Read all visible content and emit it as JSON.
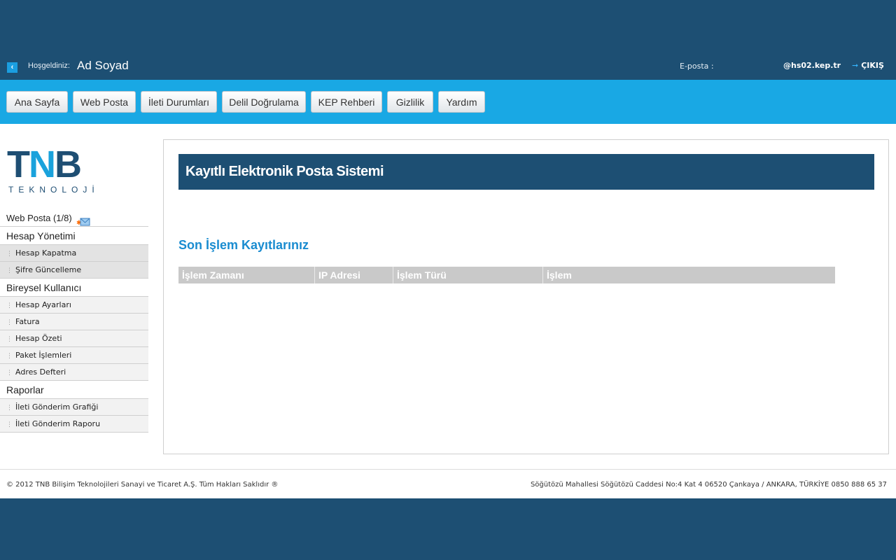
{
  "topbar": {
    "welcome_label": "Hoşgeldiniz:",
    "user_name": "Ad Soyad",
    "email_label": "E-posta :",
    "email_value": "@hs02.kep.tr",
    "logout_label": "ÇIKIŞ"
  },
  "nav": [
    {
      "label": "Ana Sayfa"
    },
    {
      "label": "Web Posta"
    },
    {
      "label": "İleti Durumları"
    },
    {
      "label": "Delil Doğrulama"
    },
    {
      "label": "KEP Rehberi"
    },
    {
      "label": "Gizlilik"
    },
    {
      "label": "Yardım"
    }
  ],
  "logo": {
    "main_a": "T",
    "main_n": "N",
    "main_b": "B",
    "sub": "TEKNOLOJİ"
  },
  "sidebar": {
    "web_posta": "Web Posta (1/8)",
    "groups": [
      {
        "title": "Hesap Yönetimi",
        "items": [
          "Hesap Kapatma",
          "Şifre Güncelleme"
        ]
      },
      {
        "title": "Bireysel Kullanıcı",
        "items": [
          "Hesap Ayarları",
          "Fatura",
          "Hesap Özeti",
          "Paket İşlemleri",
          "Adres Defteri"
        ]
      },
      {
        "title": "Raporlar",
        "items": [
          "İleti Gönderim Grafiği",
          "İleti Gönderim Raporu"
        ]
      }
    ]
  },
  "main": {
    "title": "Kayıtlı Elektronik Posta Sistemi",
    "section_title": "Son İşlem Kayıtlarınız",
    "columns": [
      "İşlem Zamanı",
      "IP Adresi",
      "İşlem Türü",
      "İşlem"
    ]
  },
  "footer": {
    "copyright": "© 2012 TNB Bilişim Teknolojileri Sanayi ve Ticaret A.Ş. Tüm Hakları Saklıdır ®",
    "address": "Söğütözü Mahallesi Söğütözü Caddesi No:4 Kat 4 06520 Çankaya / ANKARA, TÜRKİYE  0850 888 65 37"
  }
}
